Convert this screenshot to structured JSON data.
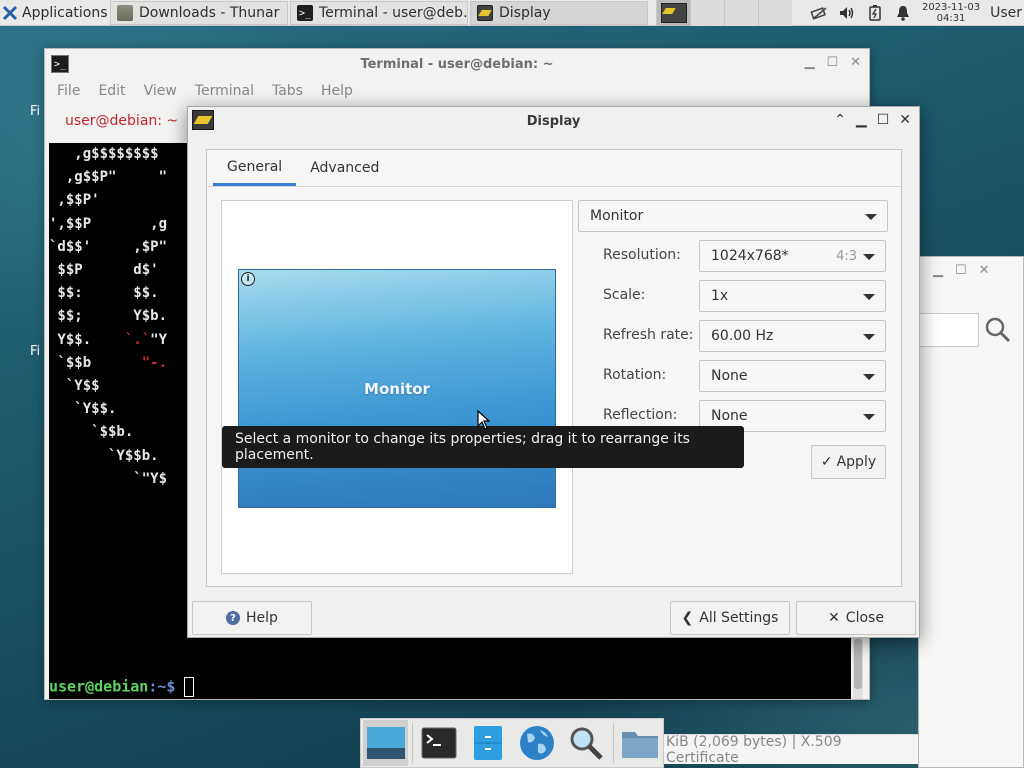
{
  "top_panel": {
    "applications_label": "Applications",
    "tasks": [
      {
        "label": "Downloads - Thunar",
        "icon": "folder-icon"
      },
      {
        "label": "Terminal - user@deb…",
        "icon": "terminal-icon"
      },
      {
        "label": "Display",
        "icon": "display-icon"
      }
    ],
    "clock_date": "2023-11-03",
    "clock_time": "04:31",
    "user": "User"
  },
  "terminal": {
    "title": "Terminal - user@debian: ~",
    "menu": [
      "File",
      "Edit",
      "View",
      "Terminal",
      "Tabs",
      "Help"
    ],
    "tab_label": "user@debian: ~",
    "prompt_user": "user@debian",
    "prompt_path": ":~$ ",
    "ascii_lines": [
      "   ,g$$$$$$$$",
      "  ,g$$P\"     \"",
      " ,$$P'",
      "',$$P       ,g",
      "`d$$'     ,$P\"",
      " $$P      d$'",
      " $$:      $$.",
      " $$;      Y$b.",
      " Y$$.    `.`\"Y",
      " `$$b      \"-.",
      "  `Y$$",
      "   `Y$$.",
      "     `$$b.",
      "       `Y$$b.",
      "          `\"Y$"
    ]
  },
  "background_window": {
    "status_text": "KiB (2,069 bytes)  |  X.509 Certificate"
  },
  "desktop_labels": [
    "Fi",
    "Fi"
  ],
  "display_dialog": {
    "title": "Display",
    "tabs": [
      "General",
      "Advanced"
    ],
    "monitor_tile_label": "Monitor",
    "monitor_selector": "Monitor",
    "properties": [
      {
        "label": "Resolution:",
        "value": "1024x768*",
        "extra": "4:3"
      },
      {
        "label": "Scale:",
        "value": "1x"
      },
      {
        "label": "Refresh rate:",
        "value": "60.00 Hz"
      },
      {
        "label": "Rotation:",
        "value": "None"
      },
      {
        "label": "Reflection:",
        "value": "None"
      }
    ],
    "apply_label": "Apply",
    "help_label": "Help",
    "all_settings_label": "All Settings",
    "close_label": "Close",
    "tooltip": "Select a monitor to change its properties; drag it to rearrange its placement."
  },
  "colors": {
    "accent_tab": "#3b7dd6",
    "terminal_tab_text": "#c0262c",
    "prompt_user": "#5fd35f"
  }
}
